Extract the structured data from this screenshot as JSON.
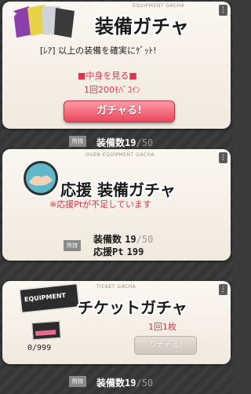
{
  "equipment_gacha": {
    "tag": "EQUIPMENT GACHA",
    "title": "装備ガチャ",
    "description": "[ﾚｱ] 以上の装備を確実にｹﾞｯﾄ!",
    "preview_link": "■中身を見る■",
    "price": "1回200ﾓﾊﾞｺｲﾝ",
    "button": "ガチャる!",
    "owned_badge": "所持",
    "equip_count_label": "装備数",
    "equip_count": "19",
    "equip_max": "/50"
  },
  "support_gacha": {
    "tag": "OUEN EQUIPMENT GACHA",
    "title": "応援 装備ガチャ",
    "warning": "※応援Ptが不足しています",
    "owned_badge": "所持",
    "equip_count_label": "装備数",
    "equip_count": "19",
    "equip_max": "/50",
    "support_pt_label": "応援Pt",
    "support_pt": "199"
  },
  "ticket_gacha": {
    "tag": "TICKET GACHA",
    "title": "チケットガチャ",
    "ticket_label": "EQUIPMENT",
    "tickets_owned": "0/999",
    "price": "1回1枚",
    "button": "ガチャる!",
    "owned_badge": "所持",
    "equip_count_label": "装備数",
    "equip_count": "19",
    "equip_max": "/50"
  },
  "colors": {
    "accent_red": "#e0344a",
    "button_pink": "#e9485c"
  }
}
